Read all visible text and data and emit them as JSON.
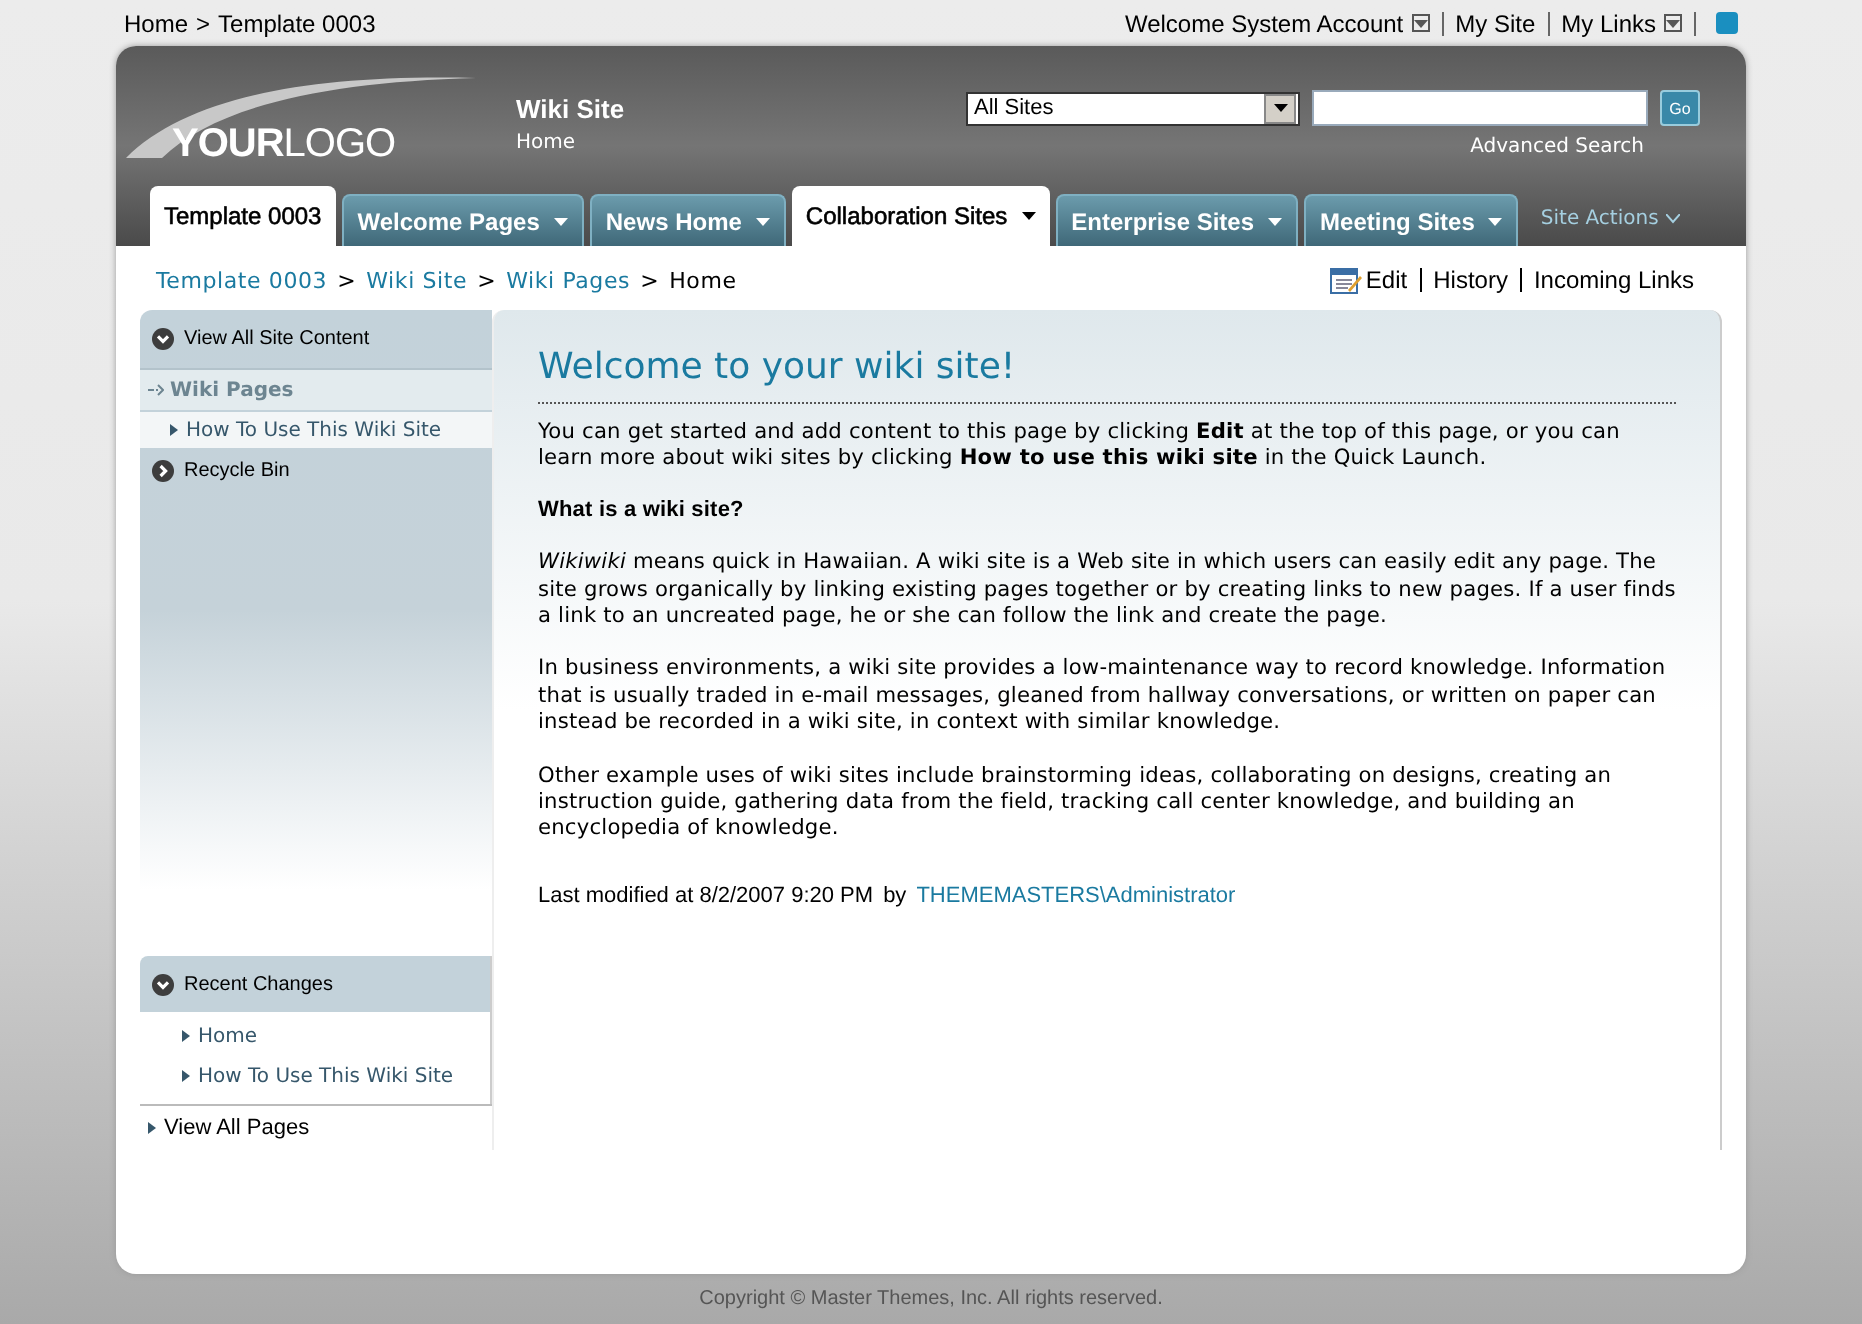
{
  "top_bar": {
    "breadcrumb": [
      "Home",
      "Template 0003"
    ],
    "separator": ">",
    "links": [
      {
        "label": "Welcome System Account",
        "dropdown": true
      },
      {
        "label": "My Site",
        "dropdown": false
      },
      {
        "label": "My Links",
        "dropdown": true
      }
    ]
  },
  "header": {
    "logo": "**YOUR**LOGO",
    "site_title": "Wiki Site",
    "site_subtitle": "Home",
    "search": {
      "scope": "All Sites",
      "button": "Go",
      "advanced": "Advanced Search"
    }
  },
  "tabs": [
    {
      "label": "Template 0003",
      "selected": true,
      "dropdown": false
    },
    {
      "label": "Welcome Pages",
      "selected": false,
      "dropdown": true
    },
    {
      "label": "News Home",
      "selected": false,
      "dropdown": true
    },
    {
      "label": "Collaboration Sites",
      "selected": true,
      "dropdown": true
    },
    {
      "label": "Enterprise Sites",
      "selected": false,
      "dropdown": true
    },
    {
      "label": "Meeting Sites",
      "selected": false,
      "dropdown": true
    }
  ],
  "site_actions": "Site Actions",
  "breadcrumb": {
    "items": [
      "Template 0003",
      "Wiki Site",
      "Wiki Pages",
      "Home"
    ],
    "separator": ">"
  },
  "page_actions": [
    "Edit",
    "History",
    "Incoming Links"
  ],
  "quick_launch": {
    "header": "View All Site Content",
    "sections": [
      {
        "label": "Wiki Pages",
        "selected": true,
        "children": [
          {
            "label": "How To Use This Wiki Site"
          }
        ]
      }
    ],
    "recycle_bin": "Recycle Bin"
  },
  "recent_changes": {
    "header": "Recent Changes",
    "items": [
      "Home",
      "How To Use This Wiki Site"
    ]
  },
  "view_all_pages": "View All Pages",
  "content": {
    "title": "Welcome to your wiki site!",
    "paragraphs": [
      {
        "kind": "text",
        "text": "You can get started and add content to this page by clicking **Edit** at the top of this page, or you can learn more about wiki sites by clicking **How to use this wiki site** in the Quick Launch."
      },
      {
        "kind": "heading",
        "text": "What is a wiki site?"
      },
      {
        "kind": "text",
        "text": "*Wikiwiki* means quick in Hawaiian. A wiki site is a Web site in which users can easily edit any page. The site grows organically by linking existing pages together or by creating links to new pages. If a user finds a link to an uncreated page, he or she can follow the link and create the page."
      },
      {
        "kind": "text",
        "text": "In business environments, a wiki site provides a low-maintenance way to record knowledge. Information that is usually traded in e-mail messages, gleaned from hallway conversations, or written on paper can instead be recorded in a wiki site, in context with similar knowledge."
      },
      {
        "kind": "text",
        "text": "Other example uses of wiki sites include brainstorming ideas, collaborating on designs, creating an instruction guide, gathering data from the field, tracking call center knowledge, and building an encyclopedia of knowledge."
      }
    ],
    "modified": "Last modified at 8/2/2007 9:20 PM",
    "by": "by",
    "author": "THEMEMASTERS\\Administrator"
  },
  "footer": "Copyright © Master Themes, Inc. All rights reserved."
}
